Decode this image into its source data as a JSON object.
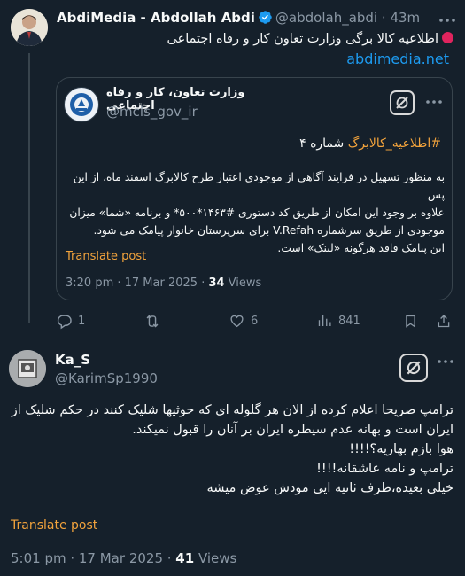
{
  "tweet1": {
    "author_name": "AbdiMedia - Abdollah Abdi",
    "author_handle": "@abdolah_abdi",
    "separator": "·",
    "time": "43m",
    "text": "اطلاعیه کالا برگی وزارت تعاون کار و رفاه اجتماعی",
    "link": "abdimedia.net",
    "quote": {
      "author_name": "وزارت تعاون، کار و رفاه اجتماعی",
      "author_handle": "@mcls_gov_ir",
      "title_hashtag": "#اطلاعیه_کالابرگ",
      "title_rest": " شماره ۴",
      "body_lines": [
        "به منظور تسهیل در فرایند آگاهی از موجودی اعتبار طرح کالابرگ اسفند ماه، از این پس",
        "علاوه بر وجود این امکان از طریق کد دستوری #۱۴۶۳*۵۰۰* و برنامه «شما» میزان",
        "موجودی از طریق سرشماره V.Refah برای سرپرستان خانوار پیامک می شود.",
        "این پیامک فاقد هرگونه «لینک» است."
      ],
      "translate_label": "Translate post",
      "timestamp": "3:20 pm · 17 Mar 2025 · ",
      "views_count": "34",
      "views_label": " Views"
    },
    "actions": {
      "replies": "1",
      "reposts": "",
      "likes": "6",
      "views": "841"
    }
  },
  "tweet2": {
    "author_name": "Ka_S",
    "author_handle": "@KarimSp1990",
    "body_lines": [
      "ترامپ صریحا اعلام کرده از الان هر گلوله ای که حوثیها شلیک کنند در حکم شلیک از",
      "ایران است و بهانه عدم سیطره ایران بر آنان را قبول نمیکند.",
      "هوا بازم بهاریه؟!!!!",
      "ترامپ و نامه عاشقانه!!!!",
      "خیلی بعیده،طرف ثانیه ایی مودش عوض میشه"
    ],
    "translate_label": "Translate post",
    "timestamp": "5:01 pm · 17 Mar 2025 · ",
    "views_count": "41",
    "views_label": " Views"
  },
  "colors": {
    "background": "#15202b",
    "text": "#f7f9f9",
    "muted": "#8b98a5",
    "link": "#1d9bf0",
    "translate": "#f2a33c",
    "border": "#38444d",
    "verified": "#1d9bf0",
    "alert_dot": "#e0245e"
  }
}
